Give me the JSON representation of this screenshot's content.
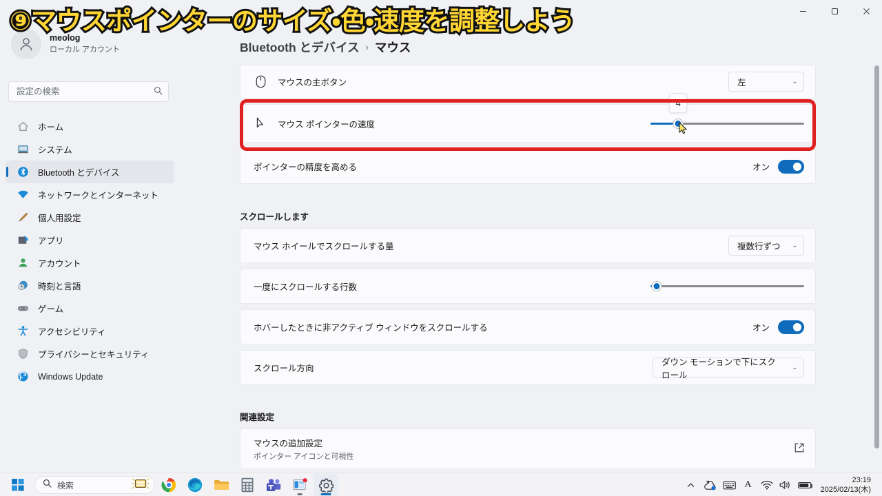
{
  "window": {
    "back_label": "←",
    "controls": {
      "minimize": "—",
      "maximize": "❐",
      "close": "✕"
    }
  },
  "overlay": {
    "title": "⑨マウスポインターのサイズ・色・速度を調整しよう",
    "text_color": "#ffd633",
    "stroke_color": "#111111"
  },
  "sidebar": {
    "account": {
      "name": "meolog",
      "type": "ローカル アカウント"
    },
    "search": {
      "placeholder": "設定の検索",
      "value": "",
      "icon": "search-icon"
    },
    "items": [
      {
        "label": "ホーム",
        "icon": "home-icon",
        "active": false
      },
      {
        "label": "システム",
        "icon": "system-icon",
        "active": false
      },
      {
        "label": "Bluetooth とデバイス",
        "icon": "bluetooth-icon",
        "active": true
      },
      {
        "label": "ネットワークとインターネット",
        "icon": "network-icon",
        "active": false
      },
      {
        "label": "個人用設定",
        "icon": "personalization-icon",
        "active": false
      },
      {
        "label": "アプリ",
        "icon": "apps-icon",
        "active": false
      },
      {
        "label": "アカウント",
        "icon": "accounts-icon",
        "active": false
      },
      {
        "label": "時刻と言語",
        "icon": "time-language-icon",
        "active": false
      },
      {
        "label": "ゲーム",
        "icon": "gaming-icon",
        "active": false
      },
      {
        "label": "アクセシビリティ",
        "icon": "accessibility-icon",
        "active": false
      },
      {
        "label": "プライバシーとセキュリティ",
        "icon": "privacy-icon",
        "active": false
      },
      {
        "label": "Windows Update",
        "icon": "update-icon",
        "active": false
      }
    ]
  },
  "breadcrumb": {
    "root": "Bluetooth とデバイス",
    "separator": "›",
    "current": "マウス"
  },
  "main": {
    "primary_button": {
      "label": "マウスの主ボタン",
      "icon": "mouse-icon",
      "dropdown_value": "左",
      "caret": "⌄"
    },
    "pointer_speed": {
      "label": "マウス ポインターの速度",
      "icon": "pointer-arrow-icon",
      "value": "4",
      "percent": 18
    },
    "enhance_precision": {
      "label": "ポインターの精度を高める",
      "state_label": "オン",
      "on": true
    },
    "scroll_section_title": "スクロールします",
    "wheel_scroll": {
      "label": "マウス ホイールでスクロールする量",
      "dropdown_value": "複数行ずつ",
      "caret": "⌄"
    },
    "lines_to_scroll": {
      "label": "一度にスクロールする行数",
      "percent": 4
    },
    "scroll_inactive": {
      "label": "ホバーしたときに非アクティブ ウィンドウをスクロールする",
      "state_label": "オン",
      "on": true
    },
    "scroll_direction": {
      "label": "スクロール方向",
      "dropdown_value": "ダウン モーションで下にスクロール",
      "caret": "⌄"
    },
    "related_section_title": "関連設定",
    "additional_mouse": {
      "label": "マウスの追加設定",
      "sub": "ポインター アイコンと可視性",
      "icon": "external-link-icon"
    }
  },
  "highlight": {
    "color": "#e02020"
  },
  "taskbar": {
    "start": {
      "icon": "windows-start-icon"
    },
    "search": {
      "label": "検索",
      "icon": "search-icon",
      "badge_icon": "keyboard-icon"
    },
    "apps": [
      {
        "name": "chrome-icon",
        "running": false
      },
      {
        "name": "edge-icon",
        "running": false
      },
      {
        "name": "file-explorer-icon",
        "running": false
      },
      {
        "name": "calculator-icon",
        "running": false
      },
      {
        "name": "teams-icon",
        "running": false
      },
      {
        "name": "store-icon",
        "running": true
      },
      {
        "name": "settings-icon",
        "running": false
      }
    ],
    "tray": [
      {
        "name": "show-hidden-icons-chevron",
        "glyph": "⌃"
      },
      {
        "name": "onedrive-sync-icon",
        "glyph": ""
      },
      {
        "name": "touch-keyboard-icon",
        "glyph": ""
      },
      {
        "name": "ime-mode-icon",
        "glyph": "A"
      },
      {
        "name": "wifi-icon",
        "glyph": ""
      },
      {
        "name": "volume-icon",
        "glyph": ""
      },
      {
        "name": "battery-icon",
        "glyph": ""
      }
    ],
    "clock": {
      "time": "23:19",
      "date": "2025/02/13(木)"
    }
  }
}
